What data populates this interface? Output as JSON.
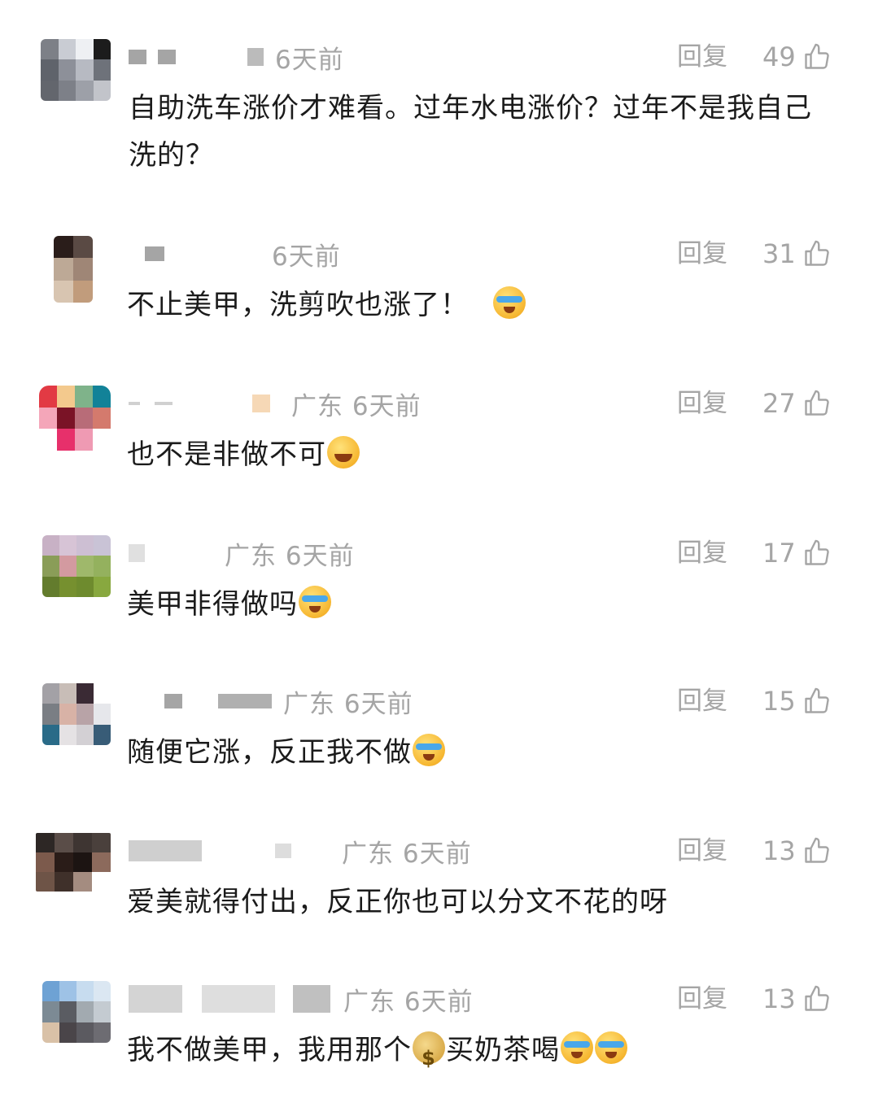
{
  "comments": [
    {
      "meta": "6天前",
      "reply": "回复",
      "likes": "49",
      "text": "自助洗车涨价才难看。过年水电涨价？过年不是我自己洗的？",
      "emojis": []
    },
    {
      "meta": "6天前",
      "reply": "回复",
      "likes": "31",
      "text": "不止美甲，洗剪吹也涨了！",
      "emojis": [
        "cry-laugh"
      ]
    },
    {
      "meta": "广东  6天前",
      "reply": "回复",
      "likes": "27",
      "text": "也不是非做不可",
      "emojis": [
        "grin"
      ]
    },
    {
      "meta": "广东  6天前",
      "reply": "回复",
      "likes": "17",
      "text": "美甲非得做吗",
      "emojis": [
        "cry-laugh"
      ]
    },
    {
      "meta": "广东  6天前",
      "reply": "回复",
      "likes": "15",
      "text": "随便它涨，反正我不做",
      "emojis": [
        "cry-laugh"
      ]
    },
    {
      "meta": "广东  6天前",
      "reply": "回复",
      "likes": "13",
      "text": "爱美就得付出，反正你也可以分文不花的呀",
      "emojis": []
    },
    {
      "meta": "广东  6天前",
      "reply": "回复",
      "likes": "13",
      "text_before": "我不做美甲，我用那个",
      "text_after": "买奶茶喝",
      "emojis": [
        "money-bag",
        "cry-laugh",
        "cry-laugh"
      ]
    }
  ],
  "icons": {
    "like": "thumbs-up-icon"
  },
  "colors": {
    "meta": "#a5a5a5",
    "text": "#1b1b1b"
  }
}
